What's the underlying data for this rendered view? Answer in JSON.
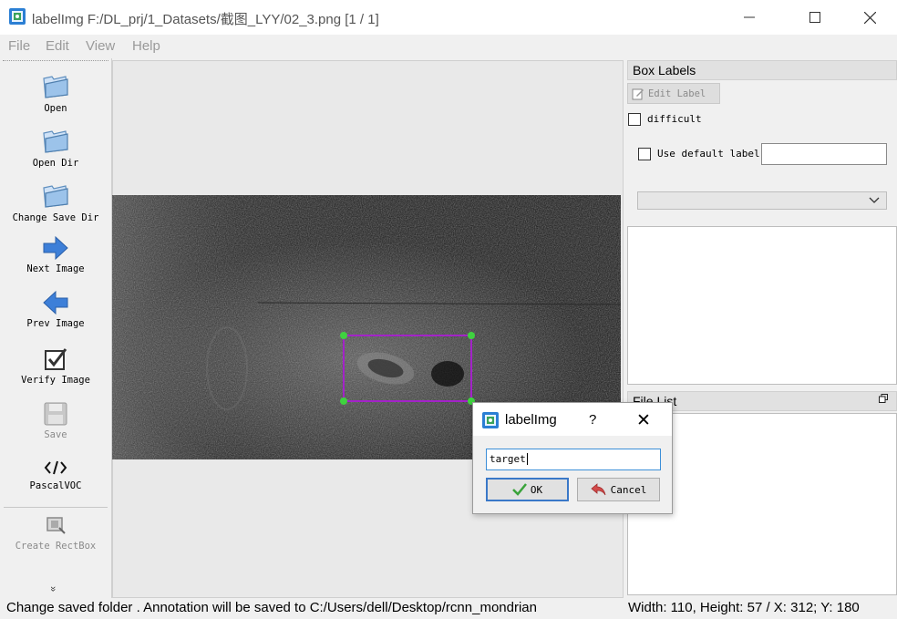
{
  "window": {
    "title": "labelImg F:/DL_prj/1_Datasets/截图_LYY/02_3.png [1 / 1]",
    "controls": {
      "minimize": "—",
      "maximize": "☐",
      "close": "✕"
    }
  },
  "menu": [
    "File",
    "Edit",
    "View",
    "Help"
  ],
  "toolbar": {
    "items": [
      {
        "label": "Open",
        "icon": "folder-icon",
        "enabled": true
      },
      {
        "label": "Open Dir",
        "icon": "folder-icon",
        "enabled": true
      },
      {
        "label": "Change Save Dir",
        "icon": "folder-icon",
        "enabled": true
      },
      {
        "label": "Next Image",
        "icon": "arrow-right-icon",
        "enabled": true
      },
      {
        "label": "Prev Image",
        "icon": "arrow-left-icon",
        "enabled": true
      },
      {
        "label": "Verify Image",
        "icon": "checkbox-icon",
        "enabled": true
      },
      {
        "label": "Save",
        "icon": "floppy-disk-icon",
        "enabled": false
      },
      {
        "label": "PascalVOC",
        "icon": "code-tag-icon",
        "enabled": true
      },
      {
        "label": "Create RectBox",
        "icon": "rectbox-icon",
        "enabled": false
      }
    ],
    "expand_glyph": "»"
  },
  "box_labels": {
    "title": "Box Labels",
    "edit_label_button": "Edit Label",
    "difficult_label": "difficult",
    "difficult_checked": false,
    "use_default_label": "Use default label",
    "use_default_checked": false,
    "default_label_value": "",
    "combo_selected": ""
  },
  "file_list": {
    "title": "File List",
    "items": []
  },
  "status": {
    "message": "Change saved folder . Annotation will be saved to C:/Users/dell/Desktop/rcnn_mondrian",
    "coords": "Width: 110, Height: 57 / X: 312; Y: 180"
  },
  "dialog": {
    "title": "labelImg",
    "help": "?",
    "close": "✕",
    "input_value": "target",
    "ok_label": "OK",
    "cancel_label": "Cancel"
  },
  "colors": {
    "bbox_stroke": "#a323c8",
    "bbox_handle": "#3fd23f",
    "focus_blue": "#3c8fd8",
    "arrow_blue": "#3d7fd8"
  }
}
